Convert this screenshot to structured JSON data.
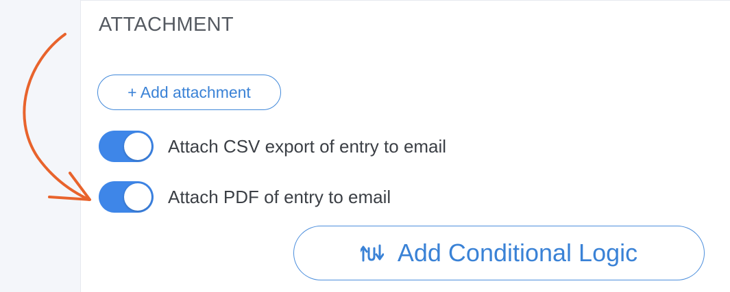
{
  "attachment_section": {
    "title": "ATTACHMENT",
    "add_attachment_label": "+ Add attachment"
  },
  "toggles": [
    {
      "label": "Attach CSV export of entry to email",
      "enabled": true
    },
    {
      "label": "Attach PDF of entry to email",
      "enabled": true
    }
  ],
  "conditional_logic": {
    "label": "Add Conditional Logic",
    "icon": "conditional-logic-icon"
  },
  "annotation": {
    "icon": "arrow-annotation-icon",
    "color": "#e8632c"
  },
  "colors": {
    "accent": "#3a82d6",
    "toggle_on": "#3e86e8",
    "annotation": "#e8632c"
  }
}
